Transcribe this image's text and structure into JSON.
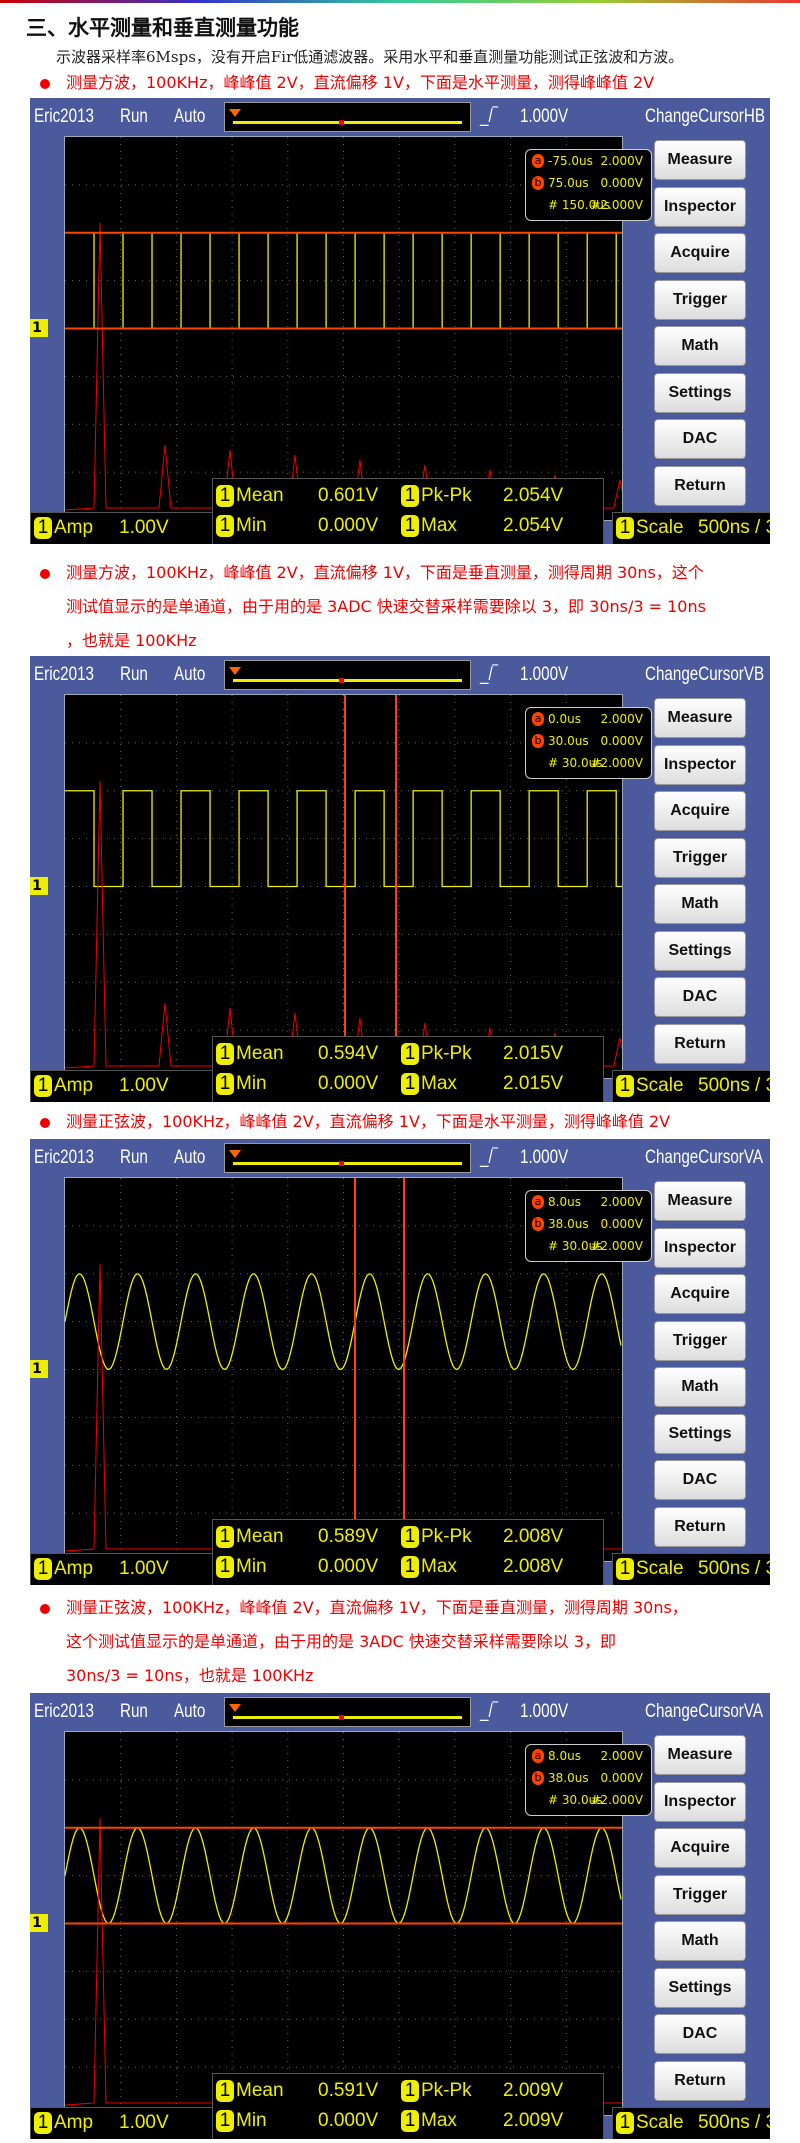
{
  "heading": "三、水平测量和垂直测量功能",
  "intro": "示波器采样率6Msps，没有开启Fir低通滤波器。采用水平和垂直测量功能测试正弦波和方波。",
  "buttons": [
    "Measure",
    "Inspector",
    "Acquire",
    "Trigger",
    "Math",
    "Settings",
    "DAC",
    "Return"
  ],
  "channel_badge": "1",
  "sections": [
    {
      "bullet": [
        "测量方波，100KHz，峰峰值 2V，直流偏移 1V，下面是水平测量，测得峰峰值 2V"
      ],
      "scope": {
        "name": "Eric2013",
        "state": "Run",
        "mode": "Auto",
        "trigger_level": "1.000V",
        "cursor_mode": "ChangeCursorHB",
        "wave": "square",
        "cursor_type": "horizontal",
        "cursor_a": {
          "label": "a",
          "time": "-75.0us",
          "volt": "2.000V"
        },
        "cursor_b": {
          "label": "b",
          "time": "75.0us",
          "volt": "0.000V"
        },
        "delta": {
          "time": "# 150.0us",
          "volt": "#2.000V"
        },
        "mean": "0.601V",
        "pkpk": "2.054V",
        "min": "0.000V",
        "max": "2.054V",
        "amp": "1.00V",
        "scale": "500ns / 3"
      }
    },
    {
      "bullet": [
        "测量方波，100KHz，峰峰值 2V，直流偏移 1V，下面是垂直测量，测得周期 30ns，这个",
        "测试值显示的是单通道，由于用的是 3ADC 快速交替采样需要除以 3，即 30ns/3 = 10ns",
        "，也就是 100KHz"
      ],
      "scope": {
        "name": "Eric2013",
        "state": "Run",
        "mode": "Auto",
        "trigger_level": "1.000V",
        "cursor_mode": "ChangeCursorVB",
        "wave": "square",
        "cursor_type": "vertical",
        "cursor_a": {
          "label": "a",
          "time": "0.0us",
          "volt": "2.000V"
        },
        "cursor_b": {
          "label": "b",
          "time": "30.0us",
          "volt": "0.000V"
        },
        "delta": {
          "time": "# 30.0us",
          "volt": "#2.000V"
        },
        "mean": "0.594V",
        "pkpk": "2.015V",
        "min": "0.000V",
        "max": "2.015V",
        "amp": "1.00V",
        "scale": "500ns / 3"
      }
    },
    {
      "bullet": [
        "测量正弦波，100KHz，峰峰值 2V，直流偏移 1V，下面是水平测量，测得峰峰值 2V"
      ],
      "scope": {
        "name": "Eric2013",
        "state": "Run",
        "mode": "Auto",
        "trigger_level": "1.000V",
        "cursor_mode": "ChangeCursorVA",
        "wave": "sine",
        "cursor_type": "vertical",
        "cursor_a": {
          "label": "a",
          "time": "8.0us",
          "volt": "2.000V"
        },
        "cursor_b": {
          "label": "b",
          "time": "38.0us",
          "volt": "0.000V"
        },
        "delta": {
          "time": "# 30.0us",
          "volt": "#2.000V"
        },
        "mean": "0.589V",
        "pkpk": "2.008V",
        "min": "0.000V",
        "max": "2.008V",
        "amp": "1.00V",
        "scale": "500ns / 3"
      }
    },
    {
      "bullet": [
        "测量正弦波，100KHz，峰峰值 2V，直流偏移 1V，下面是垂直测量，测得周期 30ns，",
        "这个测试值显示的是单通道，由于用的是 3ADC 快速交替采样需要除以 3，即",
        "30ns/3 = 10ns，也就是 100KHz"
      ],
      "scope": {
        "name": "Eric2013",
        "state": "Run",
        "mode": "Auto",
        "trigger_level": "1.000V",
        "cursor_mode": "ChangeCursorVA",
        "wave": "sine",
        "cursor_type": "horizontal",
        "cursor_a": {
          "label": "a",
          "time": "8.0us",
          "volt": "2.000V"
        },
        "cursor_b": {
          "label": "b",
          "time": "38.0us",
          "volt": "0.000V"
        },
        "delta": {
          "time": "# 30.0us",
          "volt": "#2.000V"
        },
        "mean": "0.591V",
        "pkpk": "2.009V",
        "min": "0.000V",
        "max": "2.009V",
        "amp": "1.00V",
        "scale": "500ns / 3"
      }
    }
  ],
  "labels": {
    "mean": "Mean",
    "pkpk": "Pk-Pk",
    "min": "Min",
    "max": "Max",
    "amp": "Amp",
    "scale": "Scale"
  }
}
